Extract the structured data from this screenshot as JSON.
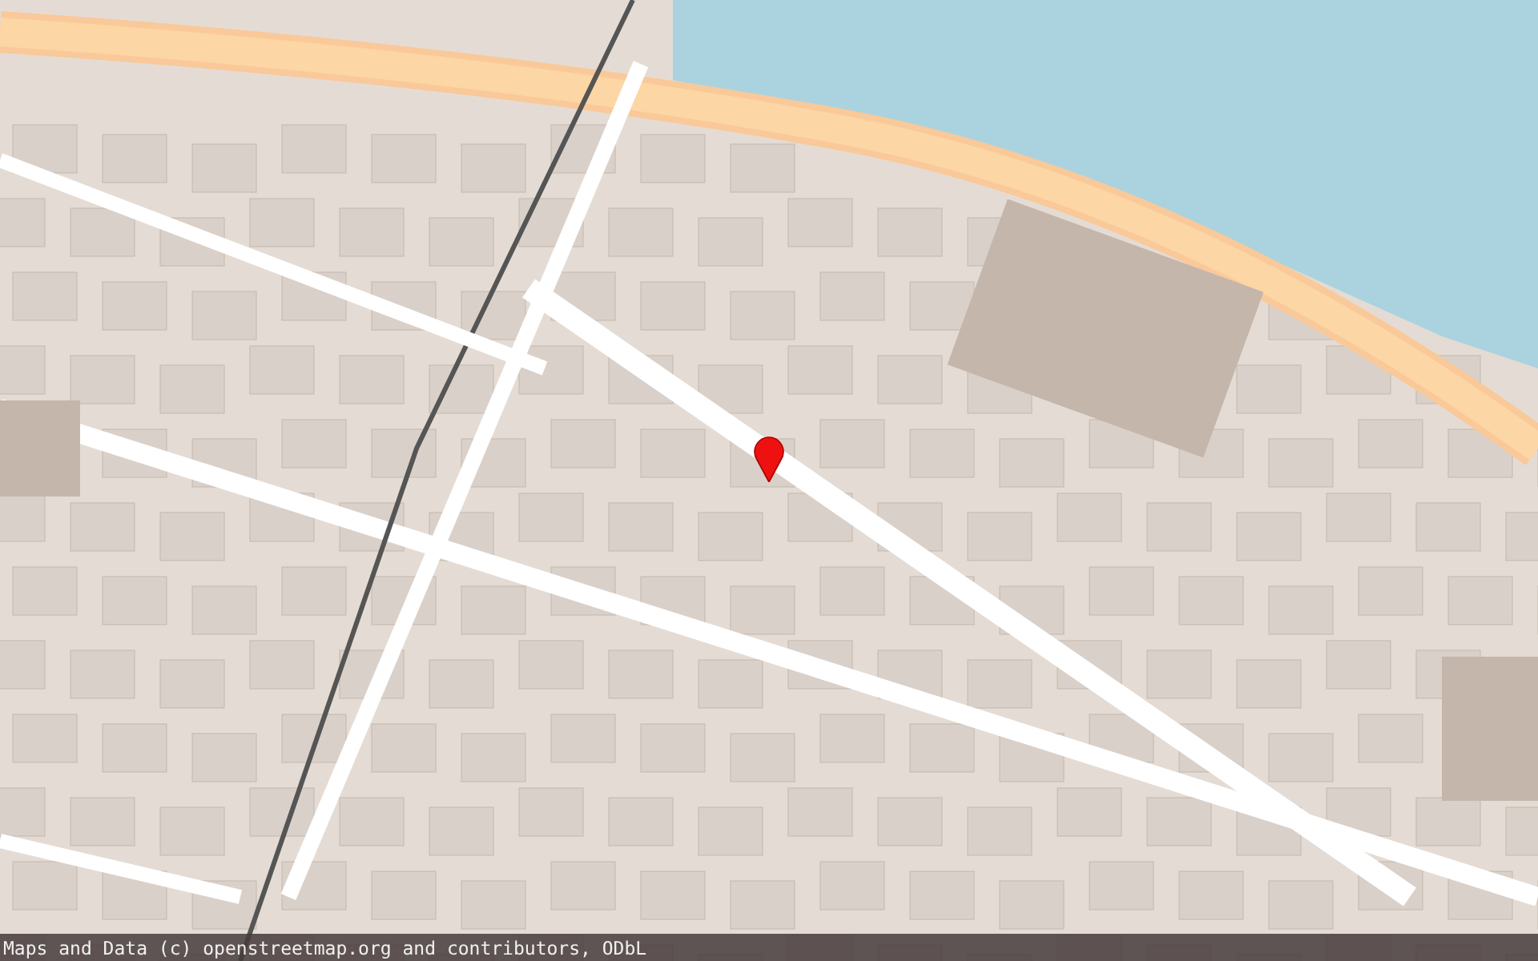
{
  "attribution": {
    "text": "Maps and Data (c) openstreetmap.org and contributors, ODbL"
  }
}
